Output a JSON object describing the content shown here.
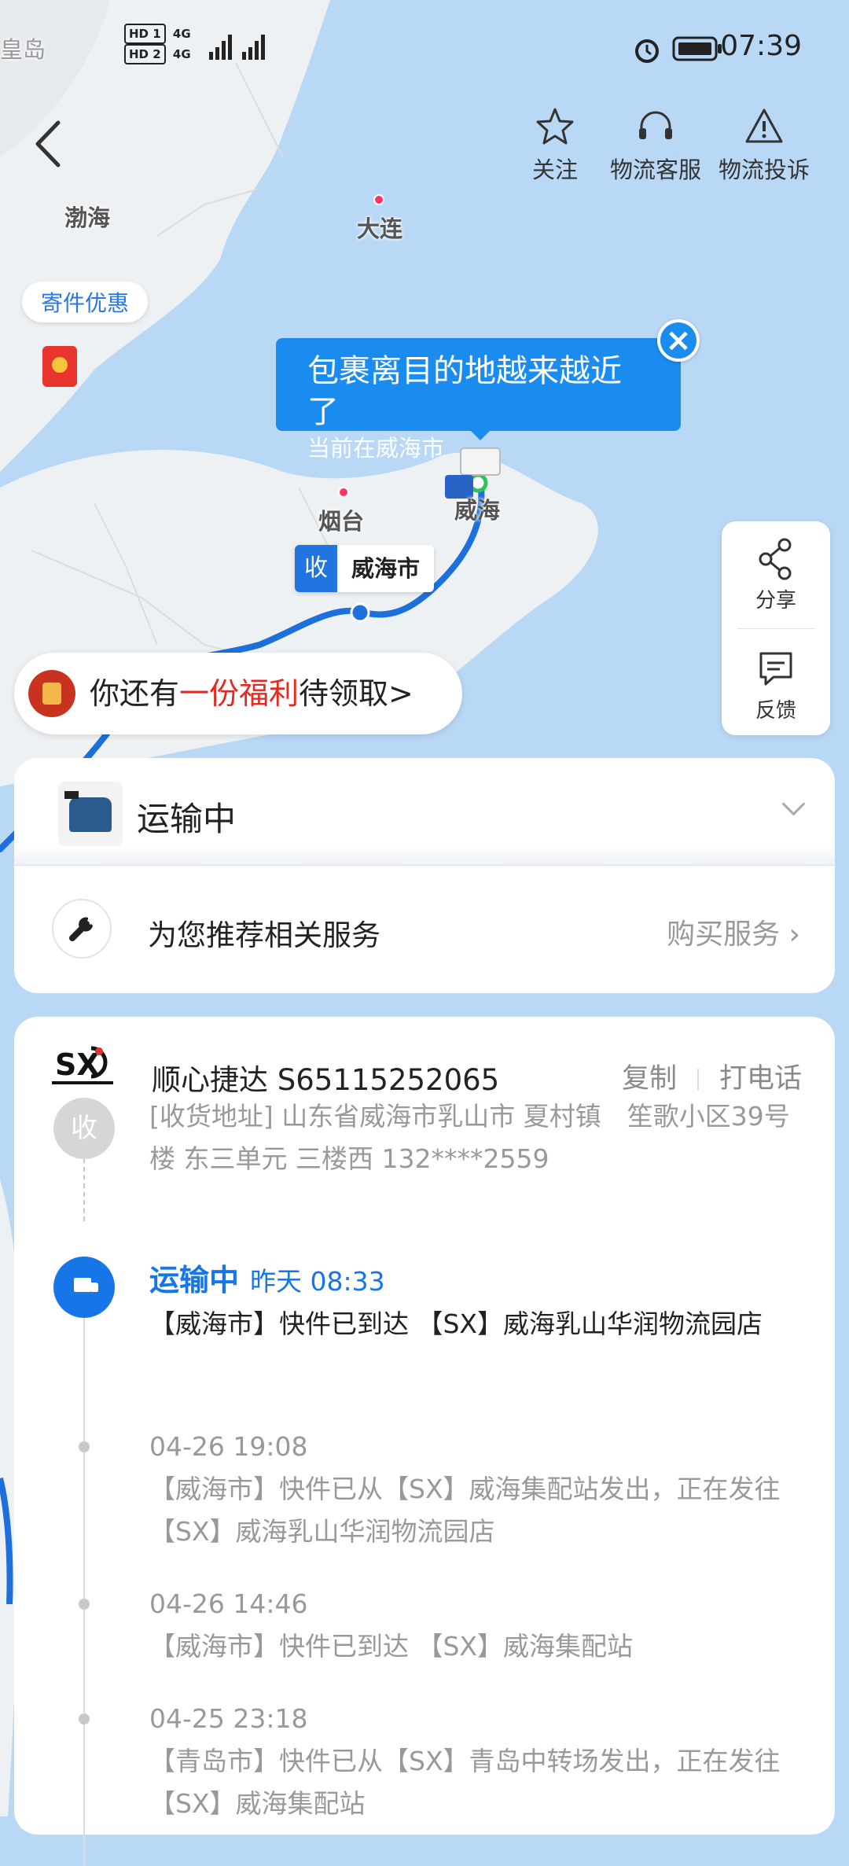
{
  "status_bar": {
    "time": "07:39",
    "sim1": "HD 1",
    "sim2": "HD 2",
    "network": "4G",
    "icons": [
      "alarm-icon",
      "battery-icon",
      "signal-icon"
    ]
  },
  "map": {
    "labels": {
      "huangdao": "皇岛",
      "bohai": "渤海",
      "dalian": "大连",
      "yantai": "烟台",
      "weihai": "威海"
    },
    "promo_chip": "寄件优惠",
    "bubble": {
      "title": "包裹离目的地越来越近了",
      "subtitle": "当前在威海市"
    },
    "receiver_pin": {
      "tag": "收",
      "city": "威海市"
    },
    "route_color": "#1d6fdc"
  },
  "top_actions": [
    {
      "label": "关注",
      "icon": "star-icon"
    },
    {
      "label": "物流客服",
      "icon": "headset-icon"
    },
    {
      "label": "物流投诉",
      "icon": "warning-icon"
    }
  ],
  "side_panel": {
    "share": "分享",
    "feedback": "反馈"
  },
  "benefit_banner": {
    "prefix": "你还有",
    "highlight": "一份福利",
    "suffix": "待领取>"
  },
  "status_card": {
    "status": "运输中"
  },
  "service_card": {
    "label": "为您推荐相关服务",
    "action": "购买服务 ›"
  },
  "tracking": {
    "carrier": "顺心捷达 S65115252065",
    "copy": "复制",
    "call": "打电话",
    "address_node": "收",
    "address": "[收货地址] 山东省威海市乳山市 夏村镇　笙歌小区39号楼  东三单元  三楼西 132****2559",
    "current": {
      "status": "运输中",
      "time": "昨天  08:33",
      "text": "【威海市】快件已到达 【SX】威海乳山华润物流园店"
    },
    "events": [
      {
        "time": "04-26  19:08",
        "text": "【威海市】快件已从【SX】威海集配站发出，正在发往【SX】威海乳山华润物流园店"
      },
      {
        "time": "04-26  14:46",
        "text": "【威海市】快件已到达 【SX】威海集配站"
      },
      {
        "time": "04-25  23:18",
        "text": "【青岛市】快件已从【SX】青岛中转场发出，正在发往【SX】威海集配站"
      }
    ]
  },
  "colors": {
    "accent": "#1676e8",
    "highlight_red": "#e52820",
    "muted": "#999999",
    "map_water": "#b9d8f5",
    "map_land": "#eef1f4"
  }
}
